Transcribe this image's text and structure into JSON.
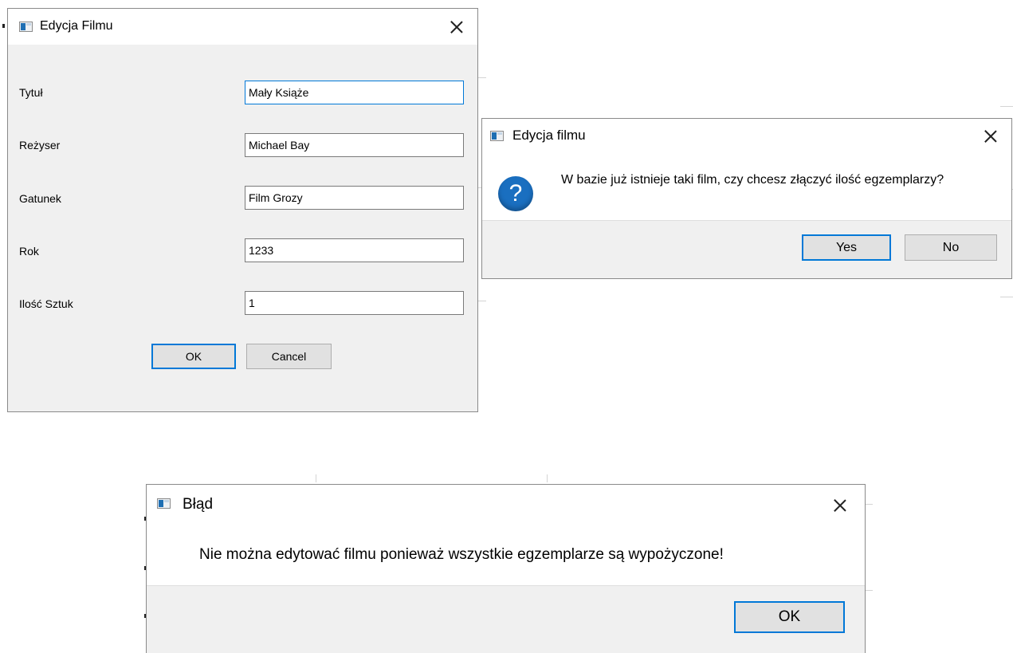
{
  "edit_dialog": {
    "title": "Edycja Filmu",
    "fields": [
      {
        "label": "Tytuł",
        "value": "Mały Książe"
      },
      {
        "label": "Reżyser",
        "value": "Michael Bay"
      },
      {
        "label": "Gatunek",
        "value": "Film Grozy"
      },
      {
        "label": "Rok",
        "value": "1233"
      },
      {
        "label": "Ilość Sztuk",
        "value": "1"
      }
    ],
    "ok_label": "OK",
    "cancel_label": "Cancel"
  },
  "confirm_dialog": {
    "title": "Edycja filmu",
    "icon": "question-icon",
    "question_glyph": "?",
    "message": "W bazie już istnieje taki film, czy chcesz złączyć ilość egzemplarzy?",
    "yes_label": "Yes",
    "no_label": "No"
  },
  "error_dialog": {
    "title": "Błąd",
    "message": "Nie można edytować filmu ponieważ wszystkie egzemplarze są wypożyczone!",
    "ok_label": "OK"
  },
  "colors": {
    "accent": "#0078d7",
    "dialog_bg": "#f0f0f0",
    "question_icon": "#1a6fc0"
  }
}
